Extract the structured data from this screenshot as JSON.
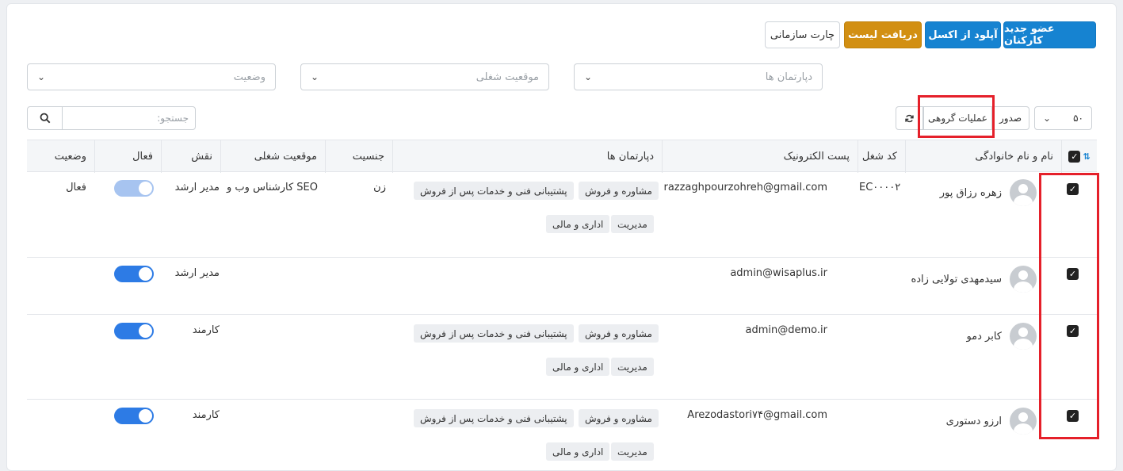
{
  "toolbar": {
    "new_member": "عضو جدید کارکنان",
    "upload_excel": "آپلود از اکسل",
    "get_list": "دریافت لیست",
    "org_chart": "چارت سازمانی"
  },
  "filters": {
    "departments": "دپارتمان ها",
    "job_position": "موقعیت شغلی",
    "status": "وضعیت"
  },
  "table_controls": {
    "page_size": "۵۰",
    "export": "صدور",
    "bulk_actions": "عملیات گروهی",
    "search_placeholder": "جستجو:"
  },
  "columns": {
    "name": "نام و نام خانوادگی",
    "code": "کد شغل",
    "email": "پست الکترونیک",
    "departments": "دپارتمان ها",
    "gender": "جنسیت",
    "position": "موقعیت شغلی",
    "role": "نقش",
    "active": "فعال",
    "status": "وضعیت"
  },
  "rows": [
    {
      "name": "زهره رزاق پور",
      "code": "EC۰۰۰۰۲",
      "email": "razzaghpourzohreh@gmail.com",
      "dept1": "مشاوره و فروش",
      "dept2": "پشتیبانی فنی و خدمات پس از فروش",
      "dept3": "مدیریت",
      "dept4": "اداری و مالی",
      "gender": "زن",
      "position": "کارشناس وب و SEO",
      "role": "مدیر ارشد",
      "status": "فعال"
    },
    {
      "name": "سیدمهدی تولایی زاده",
      "email": "admin@wisaplus.ir",
      "role": "مدیر ارشد"
    },
    {
      "name": "کابر دمو",
      "email": "admin@demo.ir",
      "dept1": "مشاوره و فروش",
      "dept2": "پشتیبانی فنی و خدمات پس از فروش",
      "dept3": "مدیریت",
      "dept4": "اداری و مالی",
      "role": "کارمند"
    },
    {
      "name": "ارزو دستوری",
      "email": "Arezodastori۷۴@gmail.com",
      "dept1": "مشاوره و فروش",
      "dept2": "پشتیبانی فنی و خدمات پس از فروش",
      "dept3": "مدیریت",
      "dept4": "اداری و مالی",
      "role": "کارمند"
    }
  ],
  "colors": {
    "primary_blue": "#1683d1",
    "gold": "#d28f12",
    "toggle_on": "#2d7be5",
    "highlight_red": "#e5202a"
  }
}
